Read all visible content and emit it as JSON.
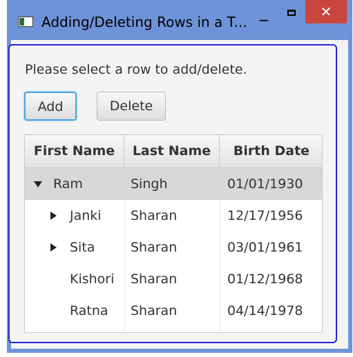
{
  "window": {
    "title": "Adding/Deleting Rows in a T...",
    "minimize_glyph": "−",
    "close_glyph": "✕"
  },
  "prompt": "Please select a row to add/delete.",
  "buttons": {
    "add": "Add",
    "delete": "Delete"
  },
  "table": {
    "columns": [
      "First Name",
      "Last Name",
      "Birth Date"
    ],
    "rows": [
      {
        "first": "Ram",
        "last": "Singh",
        "birth": "01/01/1930",
        "expander": "expanded",
        "level": 0,
        "selected": true
      },
      {
        "first": "Janki",
        "last": "Sharan",
        "birth": "12/17/1956",
        "expander": "collapsed",
        "level": 1,
        "selected": false
      },
      {
        "first": "Sita",
        "last": "Sharan",
        "birth": "03/01/1961",
        "expander": "collapsed",
        "level": 1,
        "selected": false
      },
      {
        "first": "Kishori",
        "last": "Sharan",
        "birth": "01/12/1968",
        "expander": "none",
        "level": 1,
        "selected": false
      },
      {
        "first": "Ratna",
        "last": "Sharan",
        "birth": "04/14/1978",
        "expander": "none",
        "level": 1,
        "selected": false
      }
    ]
  },
  "colors": {
    "window_frame": "#6f93d8",
    "close_button": "#c9463d",
    "focus_ring": "#2424d6",
    "selected_row": "#d8d8d8"
  }
}
